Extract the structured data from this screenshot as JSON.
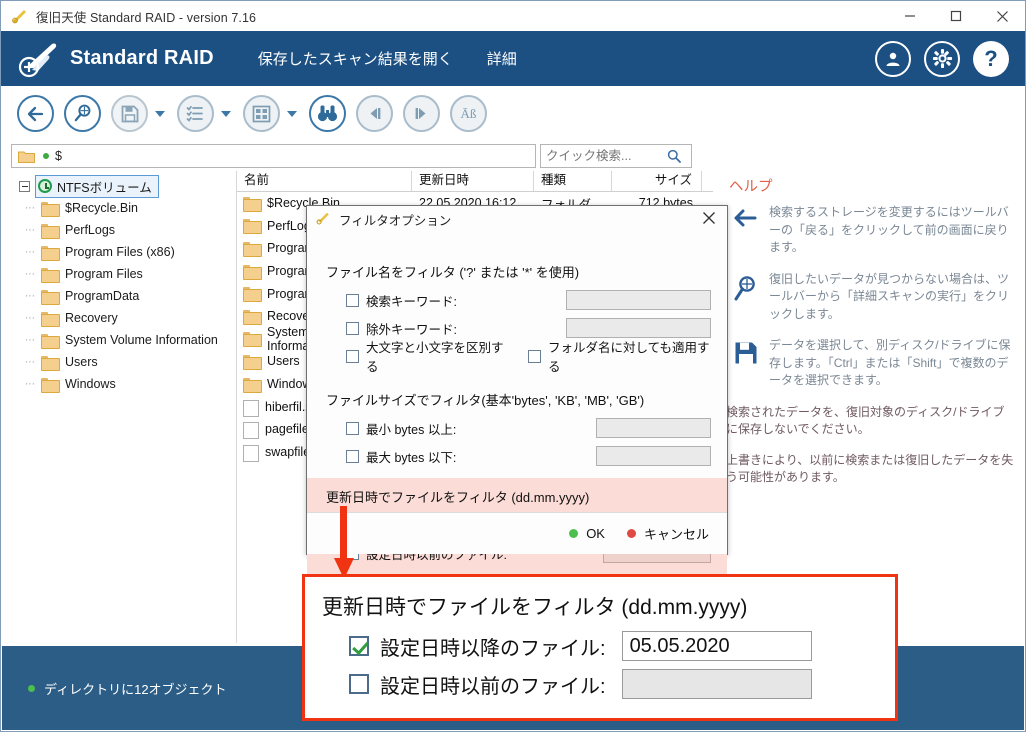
{
  "window": {
    "title": "復旧天使 Standard RAID - version 7.16",
    "minimize": "—",
    "maximize": "□",
    "close": "✕"
  },
  "header": {
    "brand": "Standard RAID",
    "links": [
      "保存したスキャン結果を開く",
      "詳細"
    ],
    "account_icon": "user-icon",
    "settings_icon": "gear-icon",
    "help_icon": "?"
  },
  "toolbar": {
    "buttons": [
      {
        "name": "back-button",
        "icon": "arrow-left-icon"
      },
      {
        "name": "advanced-scan-button",
        "icon": "magnifier-scan-icon"
      },
      {
        "name": "save-button",
        "icon": "floppy-save-icon"
      },
      {
        "name": "list-view-button",
        "icon": "list-icon"
      },
      {
        "name": "grid-view-button",
        "icon": "grid-icon"
      },
      {
        "name": "find-button",
        "icon": "binoculars-icon"
      },
      {
        "name": "previous-button",
        "icon": "step-back-icon"
      },
      {
        "name": "next-button",
        "icon": "step-forward-icon"
      },
      {
        "name": "encoding-button",
        "icon": "text-encoding-icon"
      }
    ]
  },
  "path": {
    "value": "$",
    "folder_icon": "folder-icon",
    "status_dot": "green-dot"
  },
  "search": {
    "placeholder": "クイック検索...",
    "value": "",
    "icon": "search-icon"
  },
  "tree": {
    "root": {
      "label": "NTFSボリューム",
      "icon": "volume-clock-icon",
      "selected": true
    },
    "items": [
      "$Recycle.Bin",
      "PerfLogs",
      "Program Files (x86)",
      "Program Files",
      "ProgramData",
      "Recovery",
      "System Volume Information",
      "Users",
      "Windows"
    ]
  },
  "filelist": {
    "columns": [
      "名前",
      "更新日時",
      "種類",
      "サイズ"
    ],
    "rows": [
      {
        "name": "$Recycle.Bin",
        "date": "22.05.2020 16:12",
        "type": "フォルダ",
        "size": "712 bytes",
        "kind": "folder"
      },
      {
        "name": "PerfLogs",
        "date": "",
        "type": "",
        "size": "",
        "kind": "folder"
      },
      {
        "name": "Program Files (x86)",
        "date": "",
        "type": "",
        "size": "",
        "kind": "folder"
      },
      {
        "name": "Program Files",
        "date": "",
        "type": "",
        "size": "",
        "kind": "folder"
      },
      {
        "name": "ProgramData",
        "date": "",
        "type": "",
        "size": "",
        "kind": "folder"
      },
      {
        "name": "Recovery",
        "date": "",
        "type": "",
        "size": "",
        "kind": "folder"
      },
      {
        "name": "System Volume Information",
        "date": "",
        "type": "",
        "size": "",
        "kind": "folder"
      },
      {
        "name": "Users",
        "date": "",
        "type": "",
        "size": "",
        "kind": "folder"
      },
      {
        "name": "Windows",
        "date": "",
        "type": "",
        "size": "",
        "kind": "folder"
      },
      {
        "name": "hiberfil.sys",
        "date": "",
        "type": "",
        "size": "",
        "kind": "file"
      },
      {
        "name": "pagefile.sys",
        "date": "",
        "type": "",
        "size": "",
        "kind": "file"
      },
      {
        "name": "swapfile.sys",
        "date": "",
        "type": "",
        "size": "",
        "kind": "file"
      }
    ]
  },
  "help": {
    "title": "ヘルプ",
    "items": [
      {
        "icon": "arrow-left-icon",
        "text": "検索するストレージを変更するにはツールバーの「戻る」をクリックして前の画面に戻ります。"
      },
      {
        "icon": "magnifier-scan-icon",
        "text": "復旧したいデータが見つからない場合は、ツールバーから「詳細スキャンの実行」をクリックします。"
      },
      {
        "icon": "floppy-save-icon",
        "text": "データを選択して、別ディスク/ドライブに保存します。「Ctrl」または「Shift」で複数のデータを選択できます。"
      }
    ],
    "notes": [
      "検索されたデータを、復旧対象のディスク/ドライブに保存しないでください。",
      "上書きにより、以前に検索または復旧したデータを失う可能性があります。"
    ]
  },
  "statusbar": {
    "text": "ディレクトリに12オブジェクト",
    "dot_color": "#4cbf4c"
  },
  "dialog": {
    "title": "フィルタオプション",
    "close_icon": "close-icon",
    "filename_section": {
      "heading": "ファイル名をフィルタ ('?' または '*' を使用)",
      "include": {
        "label": "検索キーワード:",
        "checked": false,
        "value": ""
      },
      "exclude": {
        "label": "除外キーワード:",
        "checked": false,
        "value": ""
      },
      "case_sensitive": {
        "label": "大文字と小文字を区別する",
        "checked": false
      },
      "apply_folders": {
        "label": "フォルダ名に対しても適用する",
        "checked": false
      }
    },
    "filesize_section": {
      "heading": "ファイルサイズでフィルタ(基本'bytes', 'KB', 'MB', 'GB')",
      "min": {
        "label": "最小 bytes 以上:",
        "checked": false,
        "value": ""
      },
      "max": {
        "label": "最大 bytes 以下:",
        "checked": false,
        "value": ""
      }
    },
    "date_section": {
      "heading": "更新日時でファイルをフィルタ (dd.mm.yyyy)",
      "after": {
        "label": "設定日時以降のファイル:",
        "checked": true,
        "value": "05.05.2020"
      },
      "before": {
        "label": "設定日時以前のファイル:",
        "checked": false,
        "value": ""
      },
      "highlight_color": "#fbdcd6"
    },
    "ok_label": "OK",
    "cancel_label": "キャンセル",
    "ok_color": "#4cbf4c",
    "cancel_color": "#e04a43"
  },
  "callout": {
    "border_color": "#f03311",
    "heading": "更新日時でファイルをフィルタ (dd.mm.yyyy)",
    "after": {
      "label": "設定日時以降のファイル:",
      "checked": true,
      "value": "05.05.2020"
    },
    "before": {
      "label": "設定日時以前のファイル:",
      "checked": false,
      "value": ""
    }
  }
}
